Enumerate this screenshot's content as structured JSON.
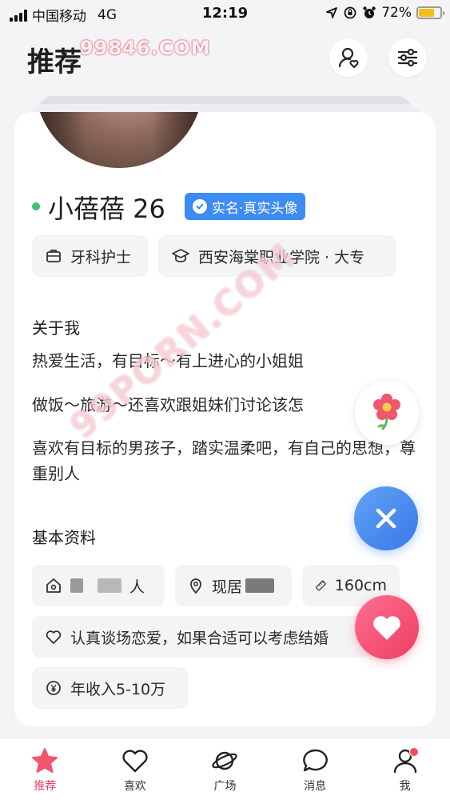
{
  "status_bar": {
    "carrier": "中国移动",
    "network": "4G",
    "time": "12:19",
    "battery_percent": "72%",
    "battery_level": 0.72
  },
  "header": {
    "title": "推荐",
    "watermark": "99846.COM"
  },
  "watermark_diag": "99PORN.COM",
  "profile": {
    "name_age": "小蓓蓓 26",
    "badge": "实名·真实头像",
    "job": "牙科护士",
    "school": "西安海棠职业学院 · 大专"
  },
  "about": {
    "title": "关于我",
    "lines": [
      "热爱生活，有目标～有上进心的小姐姐",
      "做饭～旅游～还喜欢跟姐妹们讨论该怎",
      "喜欢有目标的男孩子，踏实温柔吧，有自己的思想，尊重别人"
    ]
  },
  "basic": {
    "title": "基本资料",
    "hometown_suffix": "人",
    "residence_prefix": "现居",
    "height": "160cm",
    "intent": "认真谈场恋爱，如果合适可以考虑结婚",
    "income": "年收入5-10万"
  },
  "tabs": [
    {
      "label": "推荐",
      "icon": "star-icon",
      "active": true
    },
    {
      "label": "喜欢",
      "icon": "heart-outline-icon"
    },
    {
      "label": "广场",
      "icon": "planet-icon"
    },
    {
      "label": "消息",
      "icon": "chat-bubble-icon"
    },
    {
      "label": "我",
      "icon": "person-icon"
    }
  ],
  "colors": {
    "accent_pink": "#ee3d63",
    "verify_blue": "#3d8cf2",
    "online_green": "#3ec46d"
  }
}
